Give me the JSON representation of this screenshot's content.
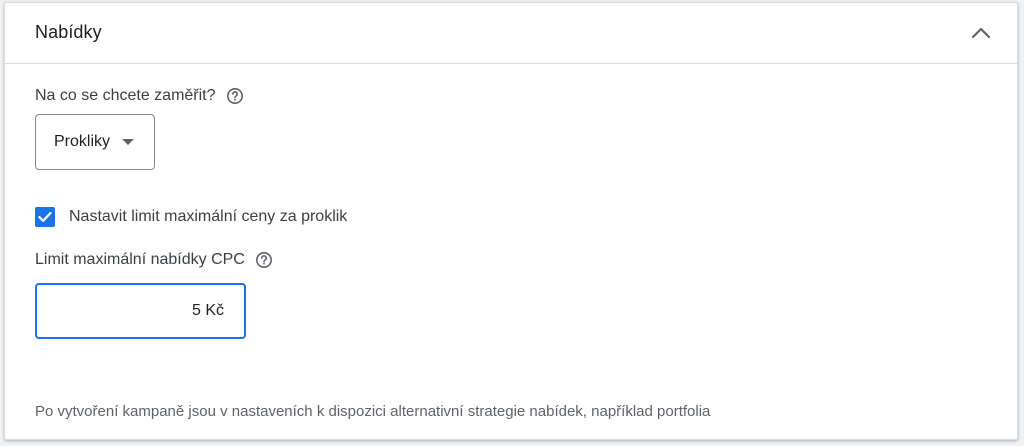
{
  "panel": {
    "title": "Nabídky",
    "collapse_icon": "chevron-up-icon"
  },
  "focus": {
    "question": "Na co se chcete zaměřit?",
    "help_icon": "help-circle-icon",
    "dropdown_value": "Prokliky"
  },
  "limit": {
    "checkbox_label": "Nastavit limit maximální ceny za proklik",
    "checked": true
  },
  "cpc": {
    "label": "Limit maximální nabídky CPC",
    "value": "5 Kč"
  },
  "note": "Po vytvoření kampaně jsou v nastaveních k dispozici alternativní strategie nabídek, například portfolia",
  "colors": {
    "accent": "#1a73e8",
    "text": "#3c4043",
    "border": "#dadce0"
  }
}
